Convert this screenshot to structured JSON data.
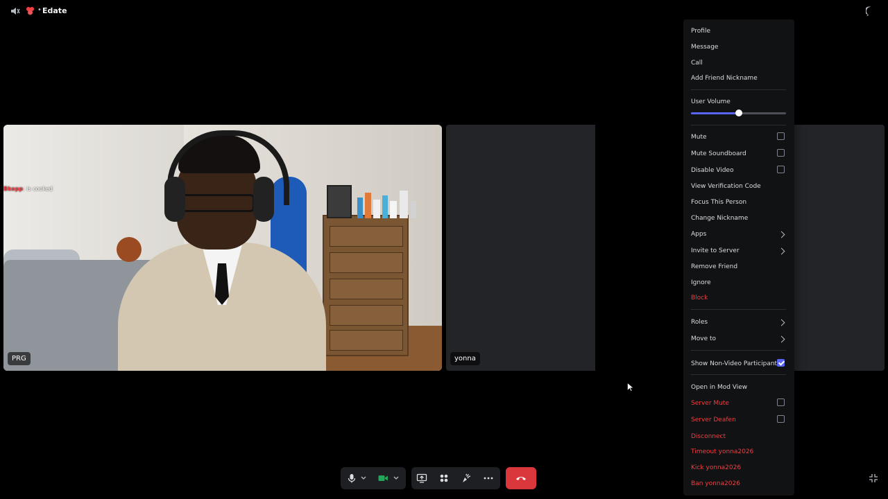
{
  "topbar": {
    "server_name": "Edate",
    "separator": "•"
  },
  "tiles": {
    "prg": {
      "name": "PRG",
      "chat_user": "Bkopp",
      "chat_text": ": is cooked"
    },
    "yonna": {
      "name": "yonna"
    }
  },
  "menu": {
    "items_top": [
      "Profile",
      "Message",
      "Call",
      "Add Friend Nickname"
    ],
    "user_volume_label": "User Volume",
    "user_volume_level": 0.5,
    "mute": "Mute",
    "mute_soundboard": "Mute Soundboard",
    "disable_video": "Disable Video",
    "view_verification_code": "View Verification Code",
    "focus_this_person": "Focus This Person",
    "change_nickname": "Change Nickname",
    "apps": "Apps",
    "invite_to_server": "Invite to Server",
    "remove_friend": "Remove Friend",
    "ignore": "Ignore",
    "block": "Block",
    "roles": "Roles",
    "move_to": "Move to",
    "show_non_video": "Show Non-Video Participants",
    "show_non_video_checked": true,
    "open_mod_view": "Open in Mod View",
    "server_mute": "Server Mute",
    "server_deafen": "Server Deafen",
    "disconnect": "Disconnect",
    "timeout": "Timeout yonna2026",
    "kick": "Kick yonna2026",
    "ban": "Ban yonna2026"
  },
  "colors": {
    "accent": "#5865f2",
    "danger": "#f23f43",
    "end_call": "#da373c",
    "camera_on": "#23a55a"
  }
}
